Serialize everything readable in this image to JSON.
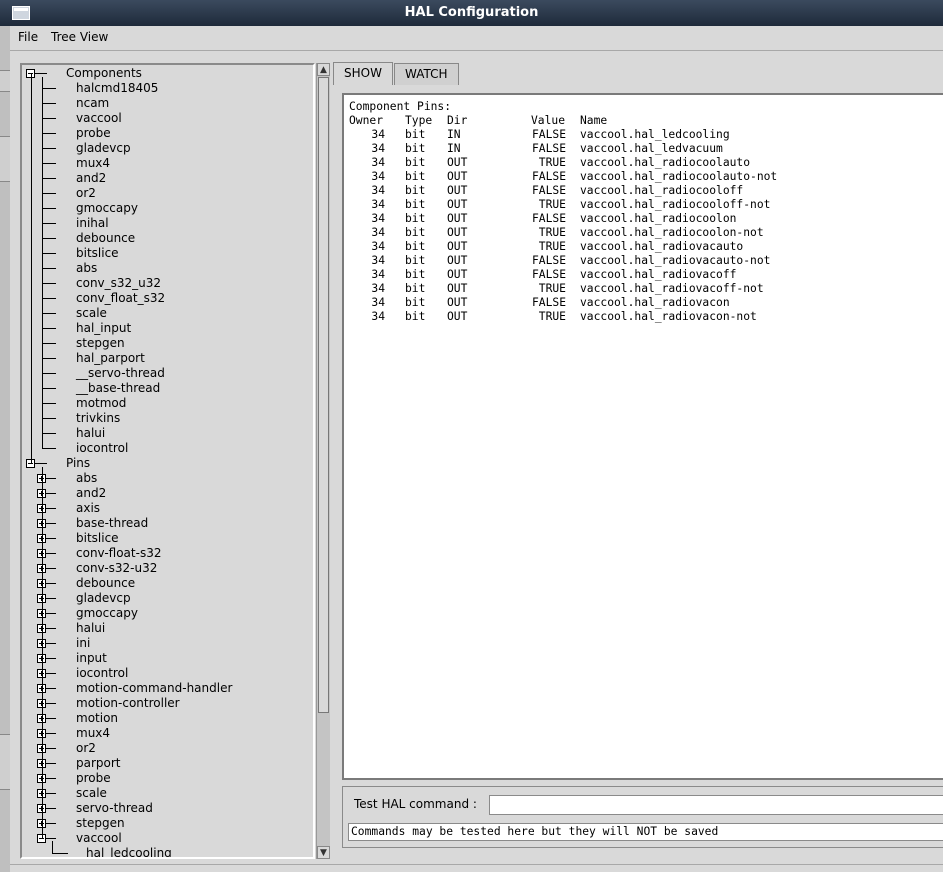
{
  "window": {
    "title": "HAL Configuration"
  },
  "menu": [
    "File",
    "Tree View"
  ],
  "tree": {
    "components_label": "Components",
    "components": [
      "halcmd18405",
      "ncam",
      "vaccool",
      "probe",
      "gladevcp",
      "mux4",
      "and2",
      "or2",
      "gmoccapy",
      "inihal",
      "debounce",
      "bitslice",
      "abs",
      "conv_s32_u32",
      "conv_float_s32",
      "scale",
      "hal_input",
      "stepgen",
      "hal_parport",
      "__servo-thread",
      "__base-thread",
      "motmod",
      "trivkins",
      "halui",
      "iocontrol"
    ],
    "pins_label": "Pins",
    "pins": [
      "abs",
      "and2",
      "axis",
      "base-thread",
      "bitslice",
      "conv-float-s32",
      "conv-s32-u32",
      "debounce",
      "gladevcp",
      "gmoccapy",
      "halui",
      "ini",
      "input",
      "iocontrol",
      "motion-command-handler",
      "motion-controller",
      "motion",
      "mux4",
      "or2",
      "parport",
      "probe",
      "scale",
      "servo-thread",
      "stepgen",
      "vaccool"
    ],
    "expanded_pin": "vaccool",
    "child": "hal_ledcooling"
  },
  "tabs": [
    {
      "label": "SHOW",
      "active": true
    },
    {
      "label": "WATCH",
      "active": false
    }
  ],
  "show": {
    "heading": "Component Pins:",
    "columns": {
      "owner": "Owner",
      "type": "Type",
      "dir": "Dir",
      "value": "Value",
      "name": "Name"
    },
    "rows": [
      {
        "owner": "34",
        "type": "bit",
        "dir": "IN",
        "value": "FALSE",
        "name": "vaccool.hal_ledcooling"
      },
      {
        "owner": "34",
        "type": "bit",
        "dir": "IN",
        "value": "FALSE",
        "name": "vaccool.hal_ledvacuum"
      },
      {
        "owner": "34",
        "type": "bit",
        "dir": "OUT",
        "value": "TRUE",
        "name": "vaccool.hal_radiocoolauto"
      },
      {
        "owner": "34",
        "type": "bit",
        "dir": "OUT",
        "value": "FALSE",
        "name": "vaccool.hal_radiocoolauto-not"
      },
      {
        "owner": "34",
        "type": "bit",
        "dir": "OUT",
        "value": "FALSE",
        "name": "vaccool.hal_radiocooloff"
      },
      {
        "owner": "34",
        "type": "bit",
        "dir": "OUT",
        "value": "TRUE",
        "name": "vaccool.hal_radiocooloff-not"
      },
      {
        "owner": "34",
        "type": "bit",
        "dir": "OUT",
        "value": "FALSE",
        "name": "vaccool.hal_radiocoolon"
      },
      {
        "owner": "34",
        "type": "bit",
        "dir": "OUT",
        "value": "TRUE",
        "name": "vaccool.hal_radiocoolon-not"
      },
      {
        "owner": "34",
        "type": "bit",
        "dir": "OUT",
        "value": "TRUE",
        "name": "vaccool.hal_radiovacauto"
      },
      {
        "owner": "34",
        "type": "bit",
        "dir": "OUT",
        "value": "FALSE",
        "name": "vaccool.hal_radiovacauto-not"
      },
      {
        "owner": "34",
        "type": "bit",
        "dir": "OUT",
        "value": "FALSE",
        "name": "vaccool.hal_radiovacoff"
      },
      {
        "owner": "34",
        "type": "bit",
        "dir": "OUT",
        "value": "TRUE",
        "name": "vaccool.hal_radiovacoff-not"
      },
      {
        "owner": "34",
        "type": "bit",
        "dir": "OUT",
        "value": "FALSE",
        "name": "vaccool.hal_radiovacon"
      },
      {
        "owner": "34",
        "type": "bit",
        "dir": "OUT",
        "value": "TRUE",
        "name": "vaccool.hal_radiovacon-not"
      }
    ]
  },
  "command": {
    "label": "Test HAL command :",
    "input_value": "",
    "output": "Commands may be tested here but they will NOT be saved"
  }
}
